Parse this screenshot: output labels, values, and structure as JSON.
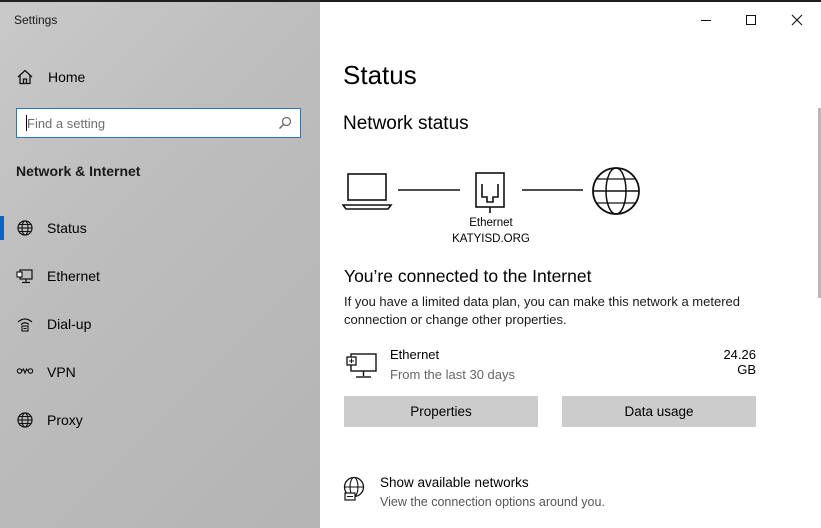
{
  "window": {
    "title": "Settings"
  },
  "sidebar": {
    "home_label": "Home",
    "search_placeholder": "Find a setting",
    "section_title": "Network & Internet",
    "items": [
      {
        "label": "Status",
        "icon": "globe-icon",
        "selected": true
      },
      {
        "label": "Ethernet",
        "icon": "ethernet-monitor-icon",
        "selected": false
      },
      {
        "label": "Dial-up",
        "icon": "dialup-icon",
        "selected": false
      },
      {
        "label": "VPN",
        "icon": "vpn-icon",
        "selected": false
      },
      {
        "label": "Proxy",
        "icon": "globe-icon",
        "selected": false
      }
    ]
  },
  "main": {
    "title": "Status",
    "network_status_heading": "Network status",
    "diagram": {
      "adapter_label": "Ethernet",
      "network_name": "KATYISD.ORG"
    },
    "connected_heading": "You’re connected to the Internet",
    "description": "If you have a limited data plan, you can make this network a metered connection or change other properties.",
    "connection": {
      "name": "Ethernet",
      "subtitle": "From the last 30 days",
      "usage": "24.26 GB"
    },
    "buttons": {
      "properties": "Properties",
      "data_usage": "Data usage"
    },
    "show_networks": {
      "title": "Show available networks",
      "subtitle": "View the connection options around you."
    }
  },
  "colors": {
    "accent": "#0a64c8",
    "search_border": "#2f73bc",
    "button_bg": "#cccccc"
  }
}
